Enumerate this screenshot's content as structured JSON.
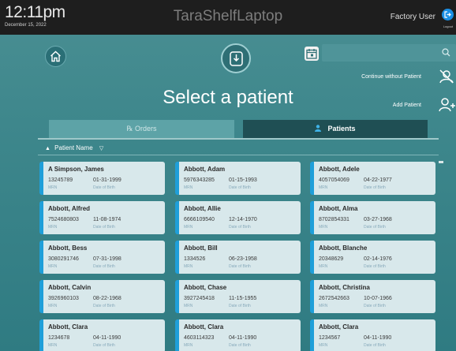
{
  "header": {
    "time": "12:11pm",
    "date": "December 15, 2022",
    "device_name": "TaraShelfLaptop",
    "user": "Factory User",
    "logout_label": "Logout"
  },
  "title": "Select a patient",
  "search": {
    "placeholder": ""
  },
  "actions": {
    "continue_without_patient": "Continue without Patient",
    "add_patient": "Add Patient"
  },
  "tabs": {
    "orders": "℞  Orders",
    "patients": "Patients"
  },
  "sort": {
    "label": "Patient Name"
  },
  "card_labels": {
    "mrn": "MRN",
    "dob": "Date of Birth"
  },
  "patients": [
    {
      "name": "A Simpson, James",
      "mrn": "13245789",
      "dob": "01-31-1999"
    },
    {
      "name": "Abbott, Adam",
      "mrn": "5976343285",
      "dob": "01-15-1993"
    },
    {
      "name": "Abbott, Adele",
      "mrn": "4057054069",
      "dob": "04-22-1977"
    },
    {
      "name": "Abbott, Alfred",
      "mrn": "7524680803",
      "dob": "11-08-1974"
    },
    {
      "name": "Abbott, Allie",
      "mrn": "6666109540",
      "dob": "12-14-1970"
    },
    {
      "name": "Abbott, Alma",
      "mrn": "8702854331",
      "dob": "03-27-1968"
    },
    {
      "name": "Abbott, Bess",
      "mrn": "3080291746",
      "dob": "07-31-1998"
    },
    {
      "name": "Abbott, Bill",
      "mrn": "1334526",
      "dob": "06-23-1958"
    },
    {
      "name": "Abbott, Blanche",
      "mrn": "20348629",
      "dob": "02-14-1976"
    },
    {
      "name": "Abbott, Calvin",
      "mrn": "3926960103",
      "dob": "08-22-1968"
    },
    {
      "name": "Abbott, Chase",
      "mrn": "3927245418",
      "dob": "11-15-1955"
    },
    {
      "name": "Abbott, Christina",
      "mrn": "2672542663",
      "dob": "10-07-1966"
    },
    {
      "name": "Abbott, Clara",
      "mrn": "1234678",
      "dob": "04-11-1990"
    },
    {
      "name": "Abbott, Clara",
      "mrn": "4603114323",
      "dob": "04-11-1990"
    },
    {
      "name": "Abbott, Clara",
      "mrn": "1234567",
      "dob": "04-11-1990"
    }
  ],
  "colors": {
    "accent": "#1f9fd9",
    "tab_active": "#1f4f54",
    "logout": "#1a8fe6"
  }
}
